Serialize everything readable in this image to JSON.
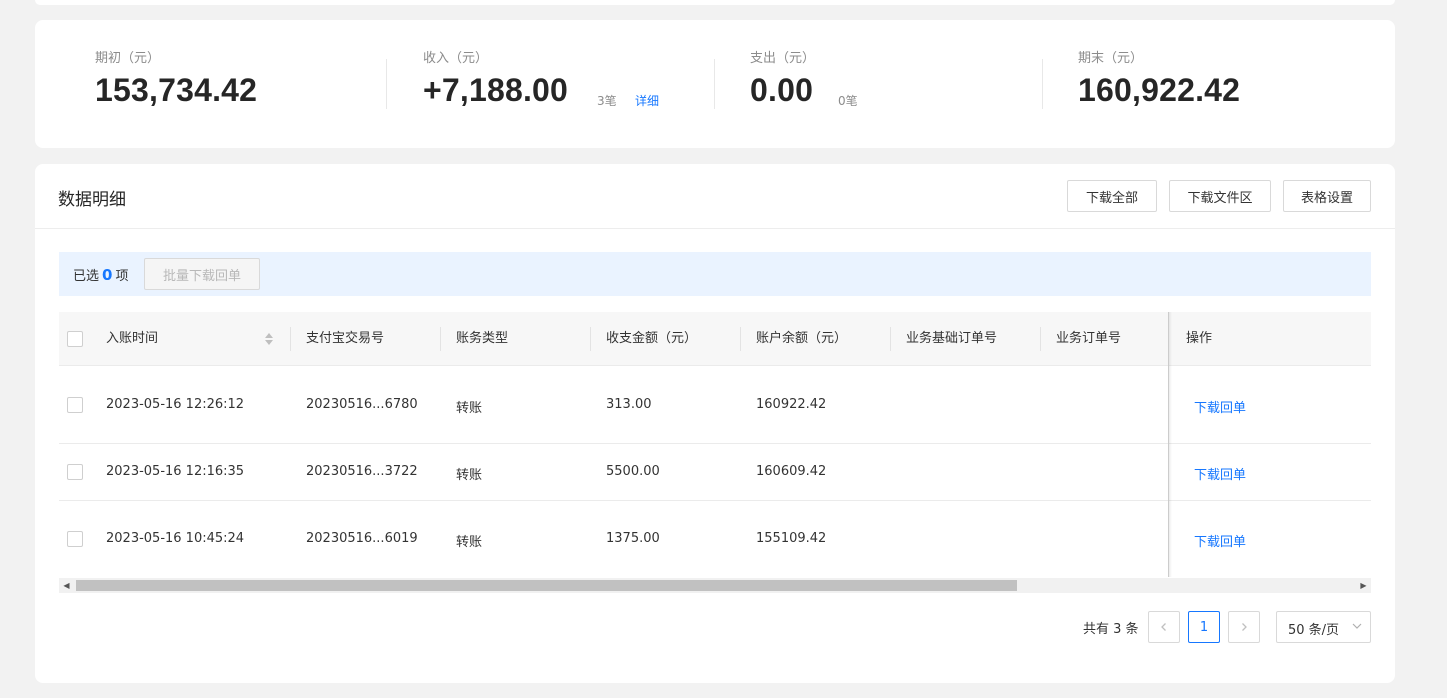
{
  "summary": {
    "opening": {
      "label": "期初（元）",
      "value": "153,734.42"
    },
    "income": {
      "label": "收入（元）",
      "value": "+7,188.00",
      "count": "3笔",
      "detail": "详细"
    },
    "expense": {
      "label": "支出（元）",
      "value": "0.00",
      "count": "0笔"
    },
    "closing": {
      "label": "期末（元）",
      "value": "160,922.42"
    }
  },
  "details": {
    "title": "数据明细",
    "buttons": {
      "download_all": "下载全部",
      "download_area": "下载文件区",
      "table_settings": "表格设置"
    },
    "selection": {
      "prefix": "已选",
      "count": "0",
      "suffix": "项",
      "batch_button": "批量下载回单"
    },
    "columns": {
      "time": "入账时间",
      "alipay_no": "支付宝交易号",
      "type": "账务类型",
      "amount": "收支金额（元）",
      "balance": "账户余额（元）",
      "biz_base_order": "业务基础订单号",
      "biz_order": "业务订单号",
      "action": "操作"
    },
    "rows": [
      {
        "time": "2023-05-16 12:26:12",
        "alipay_no": "20230516...6780",
        "type": "转账",
        "amount": "313.00",
        "balance": "160922.42",
        "action": "下载回单"
      },
      {
        "time": "2023-05-16 12:16:35",
        "alipay_no": "20230516...3722",
        "type": "转账",
        "amount": "5500.00",
        "balance": "160609.42",
        "action": "下载回单"
      },
      {
        "time": "2023-05-16 10:45:24",
        "alipay_no": "20230516...6019",
        "type": "转账",
        "amount": "1375.00",
        "balance": "155109.42",
        "action": "下载回单"
      }
    ],
    "pagination": {
      "total": "共有 3 条",
      "current_page": "1",
      "page_size": "50 条/页"
    }
  },
  "icons": {
    "sort": "sort-icon",
    "prev": "chevron-left-icon",
    "next": "chevron-right-icon",
    "dropdown": "chevron-down-icon"
  },
  "colors": {
    "accent": "#1677ff",
    "selection_bar": "#eaf3ff"
  }
}
